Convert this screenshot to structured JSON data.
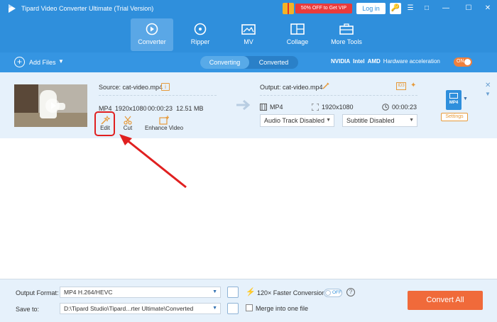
{
  "window": {
    "title": "Tipard Video Converter Ultimate (Trial Version)",
    "promo": "50% OFF to Get VIP",
    "login": "Log in"
  },
  "nav": {
    "items": [
      {
        "label": "Converter",
        "icon": "converter-icon"
      },
      {
        "label": "Ripper",
        "icon": "disc-icon"
      },
      {
        "label": "MV",
        "icon": "mv-icon"
      },
      {
        "label": "Collage",
        "icon": "collage-icon"
      },
      {
        "label": "More Tools",
        "icon": "toolbox-icon"
      }
    ],
    "active": "Converter"
  },
  "toolbar": {
    "add_files": "Add Files",
    "tab_converting": "Converting",
    "tab_converted": "Converted",
    "hw_nvidia": "NVIDIA",
    "hw_intel": "Intel",
    "hw_amd": "AMD",
    "hw_label": "Hardware acceleration",
    "hw_toggle": "ON"
  },
  "file": {
    "source": "Source: cat-video.mp4",
    "format": "MP4",
    "resolution": "1920x1080",
    "duration": "00:00:23",
    "size": "12.51 MB",
    "tools": {
      "edit": "Edit",
      "cut": "Cut",
      "enhance": "Enhance Video"
    },
    "output": "Output: cat-video.mp4",
    "out_format": "MP4",
    "out_resolution": "1920x1080",
    "out_duration": "00:00:23",
    "audio_track": "Audio Track Disabled",
    "subtitle": "Subtitle Disabled",
    "format_badge": "MP4",
    "settings": "Settings"
  },
  "bottom": {
    "output_format_label": "Output Format:",
    "output_format_value": "MP4 H.264/HEVC",
    "save_to_label": "Save to:",
    "save_to_value": "D:\\Tipard Studio\\Tipard...rter Ultimate\\Converted",
    "faster": "120× Faster Conversion",
    "faster_toggle": "OFF",
    "merge": "Merge into one file",
    "convert_all": "Convert All"
  },
  "colors": {
    "primary": "#2f8fdc",
    "accent": "#f06a3a",
    "highlight": "#e02020"
  }
}
